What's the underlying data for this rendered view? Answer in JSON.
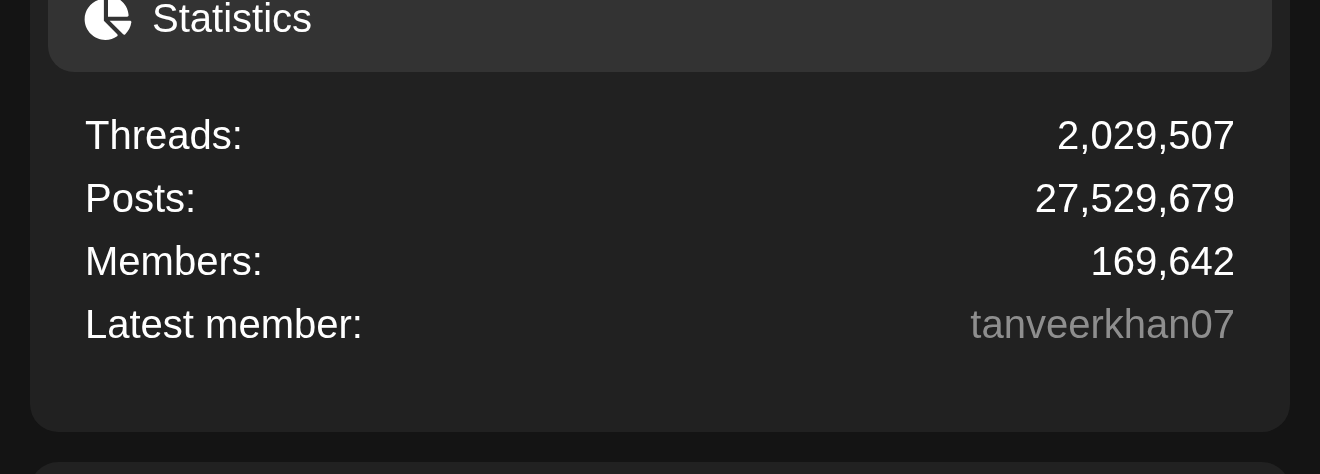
{
  "panel": {
    "title": "Statistics"
  },
  "stats": [
    {
      "label": "Threads:",
      "value": "2,029,507",
      "kind": "number"
    },
    {
      "label": "Posts:",
      "value": "27,529,679",
      "kind": "number"
    },
    {
      "label": "Members:",
      "value": "169,642",
      "kind": "number"
    },
    {
      "label": "Latest member:",
      "value": "tanveerkhan07",
      "kind": "link"
    }
  ]
}
